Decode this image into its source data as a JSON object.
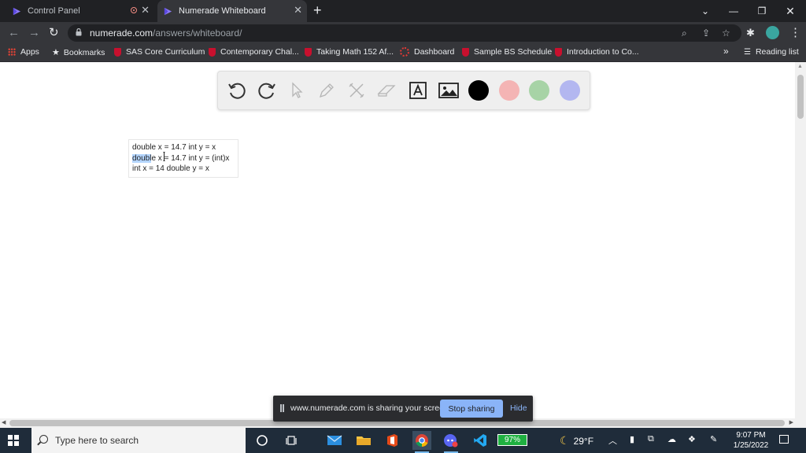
{
  "browser": {
    "tabs": [
      {
        "label": "Control Panel",
        "active": false
      },
      {
        "label": "Numerade Whiteboard",
        "active": true
      }
    ],
    "url_host": "numerade.com",
    "url_path": "/answers/whiteboard/",
    "bookmarks": [
      {
        "label": "Apps"
      },
      {
        "label": "Bookmarks"
      },
      {
        "label": "SAS Core Curriculum"
      },
      {
        "label": "Contemporary Chal..."
      },
      {
        "label": "Taking Math 152 Af..."
      },
      {
        "label": "Dashboard"
      },
      {
        "label": "Sample BS Schedule"
      },
      {
        "label": "Introduction to Co..."
      }
    ],
    "overflow_label": "»",
    "reading_list": "Reading list"
  },
  "whiteboard": {
    "tools": [
      "undo-icon",
      "redo-icon",
      "pointer-icon",
      "pen-icon",
      "tools-icon",
      "eraser-icon",
      "text-icon",
      "image-icon"
    ],
    "colors": [
      "#000000",
      "#f4b4b4",
      "#a7d3a6",
      "#b3b7f0"
    ],
    "text_lines": {
      "l1": "double x = 14.7 int y = x",
      "l2_sel": "doubl",
      "l2_rest": "e x = 14.7 int y = (int)x",
      "l3": "int x = 14 double y = x"
    }
  },
  "sharing": {
    "message": "www.numerade.com is sharing your screen.",
    "stop_label": "Stop sharing",
    "hide_label": "Hide"
  },
  "taskbar": {
    "search_placeholder": "Type here to search",
    "battery": "97%",
    "temperature": "29°F",
    "time": "9:07 PM",
    "date": "1/25/2022"
  },
  "colors": {
    "chrome_dark": "#202124",
    "chrome_mid": "#35363a",
    "accent_blue": "#8ab4f8",
    "taskbar": "#1f2c3a",
    "brand_purple": "#6f5df0"
  }
}
